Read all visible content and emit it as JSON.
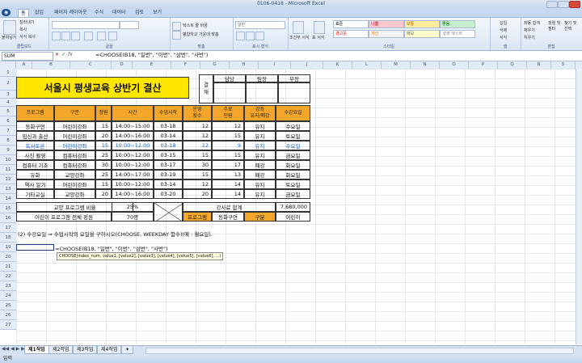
{
  "window": {
    "title": "0106-0418 - Microsoft Excel"
  },
  "tabs": [
    "홈",
    "삽입",
    "페이지 레이아웃",
    "수식",
    "데이터",
    "검토",
    "보기"
  ],
  "ribbon": {
    "paste": "붙여넣기",
    "cut": "잘라내기",
    "copy": "복사",
    "format_painter": "서식 복사",
    "wrap": "텍스트 줄 바꿈",
    "merge": "병합하고 가운데 맞춤",
    "number_format": "일반",
    "styles": [
      "표준",
      "나쁨",
      "보통",
      "좋음"
    ],
    "styles2": [
      "경고문",
      "계산",
      "메모",
      "설명 텍스트"
    ],
    "cond_format": "조건부 서식",
    "table_format": "표 서식",
    "cell_style": "셀 스타일",
    "insert": "삽입",
    "delete": "삭제",
    "format": "서식",
    "autosum": "자동 합계",
    "fill": "채우기",
    "clear": "지우기",
    "sort": "정렬 및 필터",
    "find": "찾기 및 선택",
    "groups": [
      "클립보드",
      "글꼴",
      "맞춤",
      "표시 형식",
      "스타일",
      "셀",
      "편집"
    ]
  },
  "formula_bar": {
    "name_box": "SUM",
    "fx": "fx",
    "formula": "=CHOOSE(B18, \"일번\", \"이번\", \"삼번\", \"사번\")"
  },
  "columns": [
    "A",
    "B",
    "C",
    "D",
    "E",
    "F",
    "G",
    "H",
    "I",
    "J",
    "K",
    "L",
    "M",
    "N",
    "O",
    "P",
    "Q",
    "R",
    "S"
  ],
  "rows": [
    "1",
    "2",
    "3",
    "4",
    "5",
    "6",
    "7",
    "8",
    "9",
    "10",
    "11",
    "12",
    "13",
    "14",
    "15",
    "16",
    "17",
    "18",
    "19",
    "20",
    "21",
    "22",
    "23",
    "24",
    "25",
    "26",
    "27"
  ],
  "sheet": {
    "title": "서울시 평생교육 상반기 결산",
    "approval": {
      "label": "결\n재",
      "roles": [
        "담당",
        "팀장",
        "부장"
      ]
    },
    "headers": [
      "프로그램",
      "구분",
      "정원",
      "시간",
      "수업시작",
      "운영\n횟수",
      "수료\n인원",
      "강좌\n유지/폐강",
      "수강요일"
    ],
    "rows": [
      [
        "동화구연",
        "어린이강좌",
        "15",
        "14:00~15:00",
        "03-18",
        "12",
        "12",
        "유지",
        "수요일"
      ],
      [
        "임신과 출산",
        "어린이강좌",
        "20",
        "14:00~16:00",
        "03-14",
        "12",
        "15",
        "유지",
        "토요일"
      ],
      [
        "독서토론",
        "어린이강좌",
        "15",
        "10:00~12:00",
        "03-18",
        "12",
        "9",
        "유지",
        "수요일"
      ],
      [
        "사진 촬영",
        "컴퓨터강좌",
        "25",
        "10:00~12:00",
        "03-15",
        "15",
        "15",
        "유지",
        "금요일"
      ],
      [
        "컴퓨터 기초",
        "컴퓨터강좌",
        "30",
        "10:00~12:00",
        "03-17",
        "30",
        "17",
        "폐강",
        "화요일"
      ],
      [
        "유화",
        "교양강좌",
        "25",
        "14:00~17:00",
        "03-19",
        "15",
        "13",
        "폐강",
        "화요일"
      ],
      [
        "역사 알기",
        "어린이강좌",
        "15",
        "10:00~12:00",
        "03-14",
        "12",
        "14",
        "유지",
        "토요일"
      ],
      [
        "기타교실",
        "교양강좌",
        "20",
        "14:00~16:00",
        "03-20",
        "20",
        "14",
        "유지",
        "금요일"
      ]
    ],
    "summary1": {
      "label": "교양 프로그램 비율",
      "value": "25%",
      "label2": "강사료 합계",
      "value2": "7,680,000"
    },
    "summary2": {
      "label": "어린이 프로그램 전체 정원",
      "value": "70명",
      "c1": "프로그램",
      "c2": "동화구연",
      "c3": "구분",
      "c4": "어린이"
    },
    "question": "(2) 수강요일 ⇒ 수업시작의 요일을 구하시오(CHOOSE, WEEKDAY 함수)(예 : 월요일).",
    "edit_text": "=CHOOSE(B18, \"일번\", \"이번\", \"삼번\", \"사번\")",
    "tooltip": "CHOOSE(index_num, value1, [value2], [value3], [value4], [value5], [value6], ...)"
  },
  "sheet_tabs": [
    "제1작업",
    "제2작업",
    "제3작업",
    "제4작업"
  ],
  "status": {
    "mode": "입력"
  }
}
